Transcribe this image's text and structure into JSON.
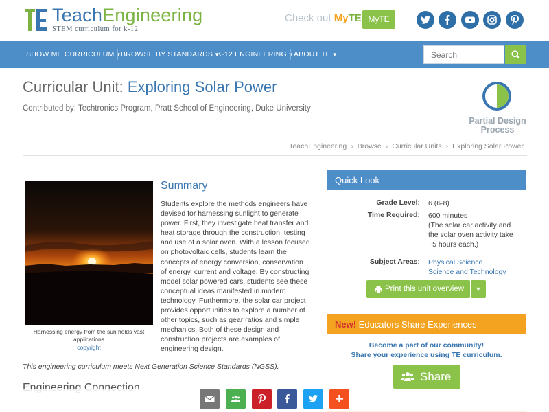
{
  "header": {
    "logo": {
      "word1": "Teach",
      "word2": "Engineering",
      "tagline": "STEM curriculum for k-12"
    },
    "checkout_prefix": "Check out ",
    "checkout_my": "My",
    "checkout_te": "TE",
    "myte_button": "MyTE",
    "social": [
      {
        "name": "twitter",
        "icon": "twitter-icon"
      },
      {
        "name": "facebook",
        "icon": "facebook-icon"
      },
      {
        "name": "youtube",
        "icon": "youtube-icon"
      },
      {
        "name": "instagram",
        "icon": "instagram-icon"
      },
      {
        "name": "pinterest",
        "icon": "pinterest-icon"
      }
    ]
  },
  "nav": {
    "items": [
      "SHOW ME CURRICULUM",
      "BROWSE BY STANDARDS",
      "K-12 ENGINEERING",
      "ABOUT TE"
    ],
    "search_placeholder": "Search"
  },
  "title": {
    "prefix": "Curricular Unit: ",
    "name": "Exploring Solar Power",
    "contributed": "Contributed by: Techtronics Program, Pratt School of Engineering, Duke University"
  },
  "design_process": {
    "label_line1": "Partial Design",
    "label_line2": "Process"
  },
  "breadcrumb": [
    "TeachEngineering",
    "Browse",
    "Curricular Units",
    "Exploring Solar Power"
  ],
  "image": {
    "caption": "Harnessing energy from the sun holds vast applications",
    "credit": "copyright"
  },
  "summary": {
    "heading": "Summary",
    "text": "Students explore the methods engineers have devised for harnessing sunlight to generate power. First, they investigate heat transfer and heat storage through the construction, testing and use of a solar oven. With a lesson focused on photovoltaic cells, students learn the concepts of energy conversion, conservation of energy, current and voltage. By constructing model solar powered cars, students see these conceptual ideas manifested in modern technology. Furthermore, the solar car project provides opportunities to explore a number of other topics, such as gear ratios and simple mechanics. Both of these design and construction projects are examples of engineering design."
  },
  "ngss_note": "This engineering curriculum meets Next Generation Science Standards (NGSS).",
  "next_section": "Engineering Connection",
  "quick_look": {
    "heading": "Quick Look",
    "grade_label": "Grade Level:",
    "grade_value": "6 (6-8)",
    "time_label": "Time Required:",
    "time_value": "600 minutes",
    "time_note": [
      "(The solar car activity and",
      "the solar oven activity take",
      "~5 hours each.)"
    ],
    "subject_label": "Subject Areas:",
    "subjects": [
      "Physical Science",
      "Science and Technology"
    ],
    "print_button": "Print this unit overview"
  },
  "share_box": {
    "new": "New!",
    "heading": " Educators Share Experiences",
    "line1": "Become a part of our community!",
    "line2": "Share your experience using TE curriculum.",
    "button": "Share"
  },
  "bottom_share": [
    {
      "name": "email",
      "color": "#777777"
    },
    {
      "name": "classroom",
      "color": "#4caf50"
    },
    {
      "name": "pinterest",
      "color": "#cb2027"
    },
    {
      "name": "facebook",
      "color": "#3b5998"
    },
    {
      "name": "twitter",
      "color": "#1da1f2"
    },
    {
      "name": "more",
      "color": "#f4511e"
    }
  ],
  "colors": {
    "brand_blue": "#3a77b1",
    "nav_blue": "#4d8ec8",
    "brand_green": "#8bc34a",
    "accent_orange": "#f3a31f"
  }
}
